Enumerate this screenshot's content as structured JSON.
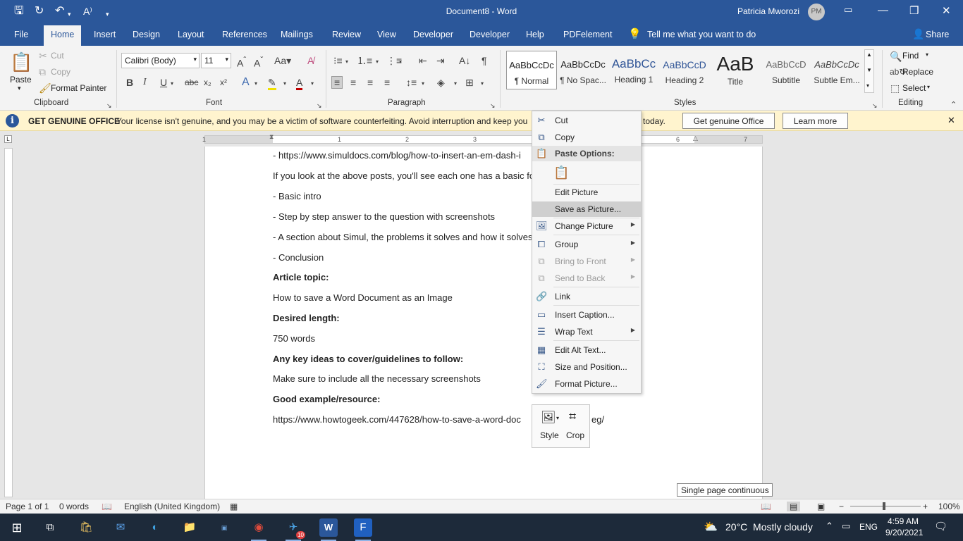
{
  "window": {
    "doc_title": "Document8 - Word",
    "user_name": "Patricia Mworozi",
    "avatar_initials": "PM",
    "minimize": "—",
    "restore": "❐",
    "close": "✕"
  },
  "tabs": [
    "File",
    "Home",
    "Insert",
    "Design",
    "Layout",
    "References",
    "Mailings",
    "Review",
    "View",
    "Developer",
    "Developer",
    "Help",
    "PDFelement"
  ],
  "tell_me": "Tell me what you want to do",
  "share": "Share",
  "ribbon": {
    "clipboard": {
      "paste": "Paste",
      "cut": "Cut",
      "copy": "Copy",
      "format_painter": "Format Painter",
      "label": "Clipboard"
    },
    "font": {
      "name": "Calibri (Body)",
      "size": "11",
      "label": "Font"
    },
    "paragraph": {
      "label": "Paragraph"
    },
    "styles": {
      "label": "Styles",
      "items": [
        {
          "sample": "AaBbCcDc",
          "name": "¶ Normal"
        },
        {
          "sample": "AaBbCcDc",
          "name": "¶ No Spac..."
        },
        {
          "sample": "AaBbCc",
          "name": "Heading 1"
        },
        {
          "sample": "AaBbCcD",
          "name": "Heading 2"
        },
        {
          "sample": "AaB",
          "name": "Title"
        },
        {
          "sample": "AaBbCcD",
          "name": "Subtitle"
        },
        {
          "sample": "AaBbCcDc",
          "name": "Subtle Em..."
        }
      ]
    },
    "editing": {
      "find": "Find",
      "replace": "Replace",
      "select": "Select",
      "label": "Editing"
    }
  },
  "banner": {
    "heading": "GET GENUINE OFFICE",
    "message": "Your license isn't genuine, and you may be a victim of software counterfeiting. Avoid interruption and keep you",
    "message_tail": "today.",
    "btn_genuine": "Get genuine Office",
    "btn_learn": "Learn more"
  },
  "ruler": [
    "1",
    "1",
    "2",
    "3",
    "6",
    "7"
  ],
  "document": {
    "lines": [
      {
        "text": "- https://www.simuldocs.com/blog/how-to-insert-an-em-dash-i",
        "bold": false
      },
      {
        "text": "If you look at the above posts, you'll see each one has a basic for",
        "bold": false
      },
      {
        "text": "- Basic intro",
        "bold": false
      },
      {
        "text": "- Step by step answer to the question with screenshots",
        "bold": false
      },
      {
        "text": "- A section about Simul, the problems it solves and how it solves",
        "bold": false
      },
      {
        "text": "- Conclusion",
        "bold": false
      },
      {
        "text": "Article topic:",
        "bold": true
      },
      {
        "text": "How to save a Word Document as an Image",
        "bold": false
      },
      {
        "text": "Desired length:",
        "bold": true
      },
      {
        "text": "750 words",
        "bold": false
      },
      {
        "text": "Any key ideas to cover/guidelines to follow:",
        "bold": true
      },
      {
        "text": "Make sure to include all the necessary screenshots",
        "bold": false
      },
      {
        "text": "Good example/resource:",
        "bold": true
      },
      {
        "text": "https://www.howtogeek.com/447628/how-to-save-a-word-doc",
        "bold": false
      }
    ],
    "url_tail": "eg/"
  },
  "context_menu": {
    "items": [
      {
        "label": "Cut",
        "icon": "scissors-icon",
        "submenu": false,
        "disabled": false
      },
      {
        "label": "Copy",
        "icon": "copy-icon",
        "submenu": false,
        "disabled": false
      },
      {
        "label": "Paste Options:",
        "icon": "paste-icon",
        "submenu": false,
        "disabled": false
      },
      {
        "label": "Edit Picture",
        "icon": "",
        "submenu": false,
        "disabled": false
      },
      {
        "label": "Save as Picture...",
        "icon": "",
        "submenu": false,
        "disabled": false,
        "highlighted": true
      },
      {
        "label": "Change Picture",
        "icon": "change-picture-icon",
        "submenu": true,
        "disabled": false
      },
      {
        "label": "Group",
        "icon": "group-icon",
        "submenu": true,
        "disabled": false
      },
      {
        "label": "Bring to Front",
        "icon": "bring-front-icon",
        "submenu": true,
        "disabled": true
      },
      {
        "label": "Send to Back",
        "icon": "send-back-icon",
        "submenu": true,
        "disabled": true
      },
      {
        "label": "Link",
        "icon": "link-icon",
        "submenu": false,
        "disabled": false
      },
      {
        "label": "Insert Caption...",
        "icon": "caption-icon",
        "submenu": false,
        "disabled": false
      },
      {
        "label": "Wrap Text",
        "icon": "wrap-text-icon",
        "submenu": true,
        "disabled": false
      },
      {
        "label": "Edit Alt Text...",
        "icon": "alt-text-icon",
        "submenu": false,
        "disabled": false
      },
      {
        "label": "Size and Position...",
        "icon": "size-position-icon",
        "submenu": false,
        "disabled": false
      },
      {
        "label": "Format Picture...",
        "icon": "format-picture-icon",
        "submenu": false,
        "disabled": false
      }
    ]
  },
  "mini_toolbar": {
    "style": "Style",
    "crop": "Crop"
  },
  "tooltip": "Single page continuous",
  "status": {
    "page": "Page 1 of 1",
    "words": "0 words",
    "language": "English (United Kingdom)",
    "zoom": "100%"
  },
  "taskbar": {
    "weather": "20°C  Mostly cloudy",
    "lang": "ENG",
    "time": "4:59 AM",
    "date": "9/20/2021",
    "notif_count": "10"
  }
}
